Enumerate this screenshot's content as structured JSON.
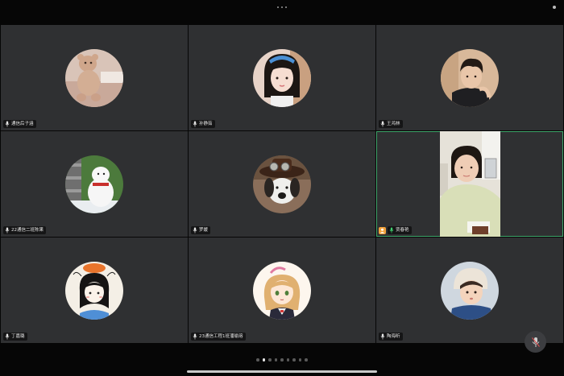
{
  "participants": [
    {
      "name": "通信后子涵",
      "avatar": "teddy-bear-photo"
    },
    {
      "name": "孙静茹",
      "avatar": "girl-selfie"
    },
    {
      "name": "王鸿林",
      "avatar": "boy-selfie"
    },
    {
      "name": "22通信二班陈果",
      "avatar": "snow-dog-photo"
    },
    {
      "name": "罗媛",
      "avatar": "plush-dog-with-hat"
    },
    {
      "name": "贾春艳",
      "avatar": "live-camera-feed",
      "video_on": true,
      "is_host": true
    },
    {
      "name": "丁嘉璐",
      "avatar": "cartoon-girl"
    },
    {
      "name": "23通信工程1班潘瑜瑢",
      "avatar": "anime-girl"
    },
    {
      "name": "陶海昕",
      "avatar": "baby-photo"
    }
  ],
  "pagination": {
    "total_pages": 9,
    "current_page": 2
  },
  "colors": {
    "tile_bg": "#2f3032",
    "background": "#060606",
    "active_border": "#3fa66b",
    "host_badge": "#f2a23c",
    "mic_active": "#3fcf6f"
  }
}
